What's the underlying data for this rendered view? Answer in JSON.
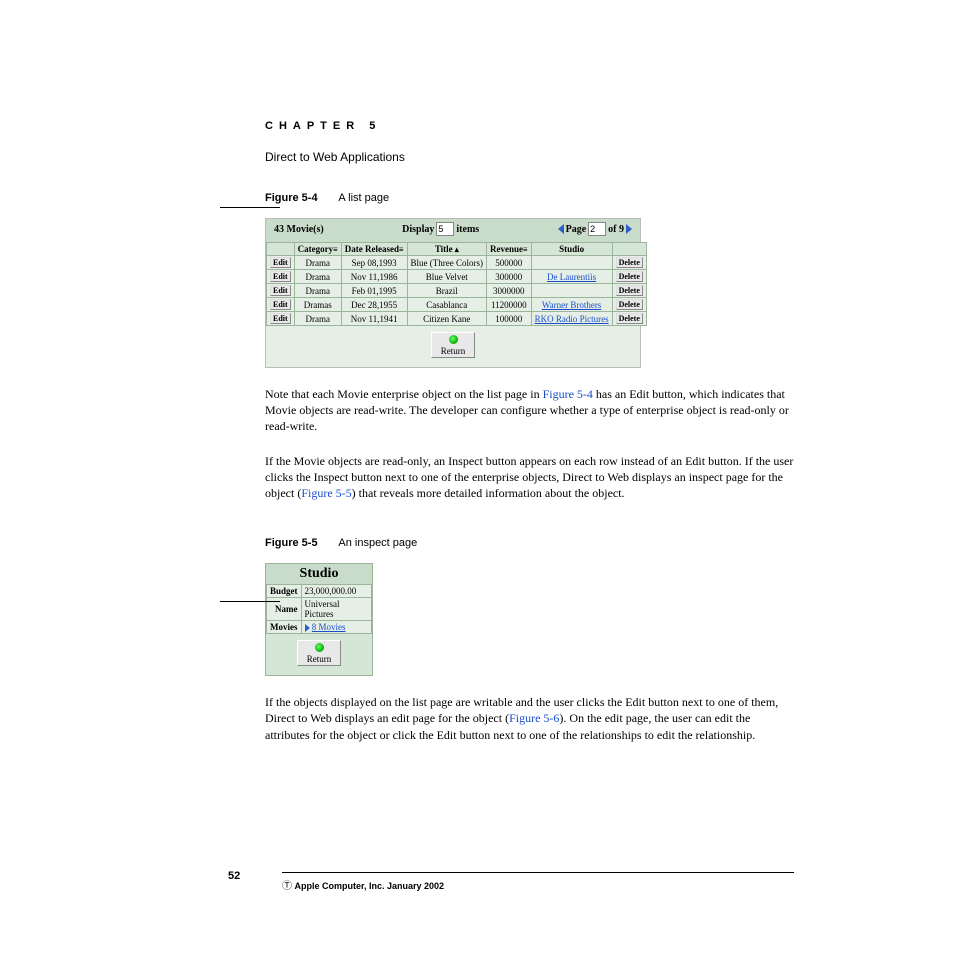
{
  "chapter_label": "CHAPTER 5",
  "section_title": "Direct to Web Applications",
  "figure1": {
    "label_prefix": "Figure 5-4",
    "caption": "A list page"
  },
  "listpage": {
    "count_text": "43 Movie(s)",
    "display_label_pre": "Display",
    "display_value": "5",
    "display_label_post": "items",
    "pager_pre": "Page",
    "pager_value": "2",
    "pager_total": "of 9",
    "columns": {
      "edit_col": "",
      "category": "Category",
      "date_released": "Date Released",
      "title": "Title",
      "revenue": "Revenue",
      "studio": "Studio",
      "delete_col": ""
    },
    "edit_btn": "Edit",
    "delete_btn": "Delete",
    "rows": [
      {
        "category": "Drama",
        "date": "Sep 08,1993",
        "title": "Blue (Three Colors)",
        "revenue": "500000",
        "studio": "",
        "studio_link": false
      },
      {
        "category": "Drama",
        "date": "Nov 11,1986",
        "title": "Blue Velvet",
        "revenue": "300000",
        "studio": "De Laurentiis",
        "studio_link": true
      },
      {
        "category": "Drama",
        "date": "Feb 01,1995",
        "title": "Brazil",
        "revenue": "3000000",
        "studio": "",
        "studio_link": false
      },
      {
        "category": "Dramas",
        "date": "Dec 28,1955",
        "title": "Casablanca",
        "revenue": "11200000",
        "studio": "Warner Brothers",
        "studio_link": true
      },
      {
        "category": "Drama",
        "date": "Nov 11,1941",
        "title": "Citizen Kane",
        "revenue": "100000",
        "studio": "RKO Radio Pictures",
        "studio_link": true
      }
    ],
    "return_label": "Return"
  },
  "para1_pre": "Note that each Movie enterprise object on the list page in ",
  "para1_xref": "Figure 5-4",
  "para1_post": " has an Edit button, which indicates that Movie objects are read-write. The developer can configure whether a type of enterprise object is read-only or read-write.",
  "para2_pre": "If the Movie objects are read-only, an Inspect button appears on each row instead of an Edit button. If the user clicks the Inspect button next to one of the enterprise objects, Direct to Web displays an inspect page for the object (",
  "para2_xref": "Figure 5-5",
  "para2_post": ") that reveals more detailed information about the object.",
  "figure2": {
    "label_prefix": "Figure 5-5",
    "caption": "An inspect page"
  },
  "inspectpage": {
    "header": "Studio",
    "rows": [
      {
        "label": "Budget",
        "value": "23,000,000.00",
        "link": false
      },
      {
        "label": "Name",
        "value": "Universal Pictures",
        "link": false
      },
      {
        "label": "Movies",
        "value": "8 Movies",
        "link": true
      }
    ],
    "return_label": "Return"
  },
  "para3_pre": "If the objects displayed on the list page are writable and the user clicks the Edit button next to one of them, Direct to Web displays an edit page for the object (",
  "para3_xref": "Figure 5-6",
  "para3_post": "). On the edit page, the user can edit the attributes for the object or click the Edit button next to one of the relationships to edit the relationship.",
  "page_number": "52",
  "copyright": "Apple Computer, Inc. January 2002"
}
